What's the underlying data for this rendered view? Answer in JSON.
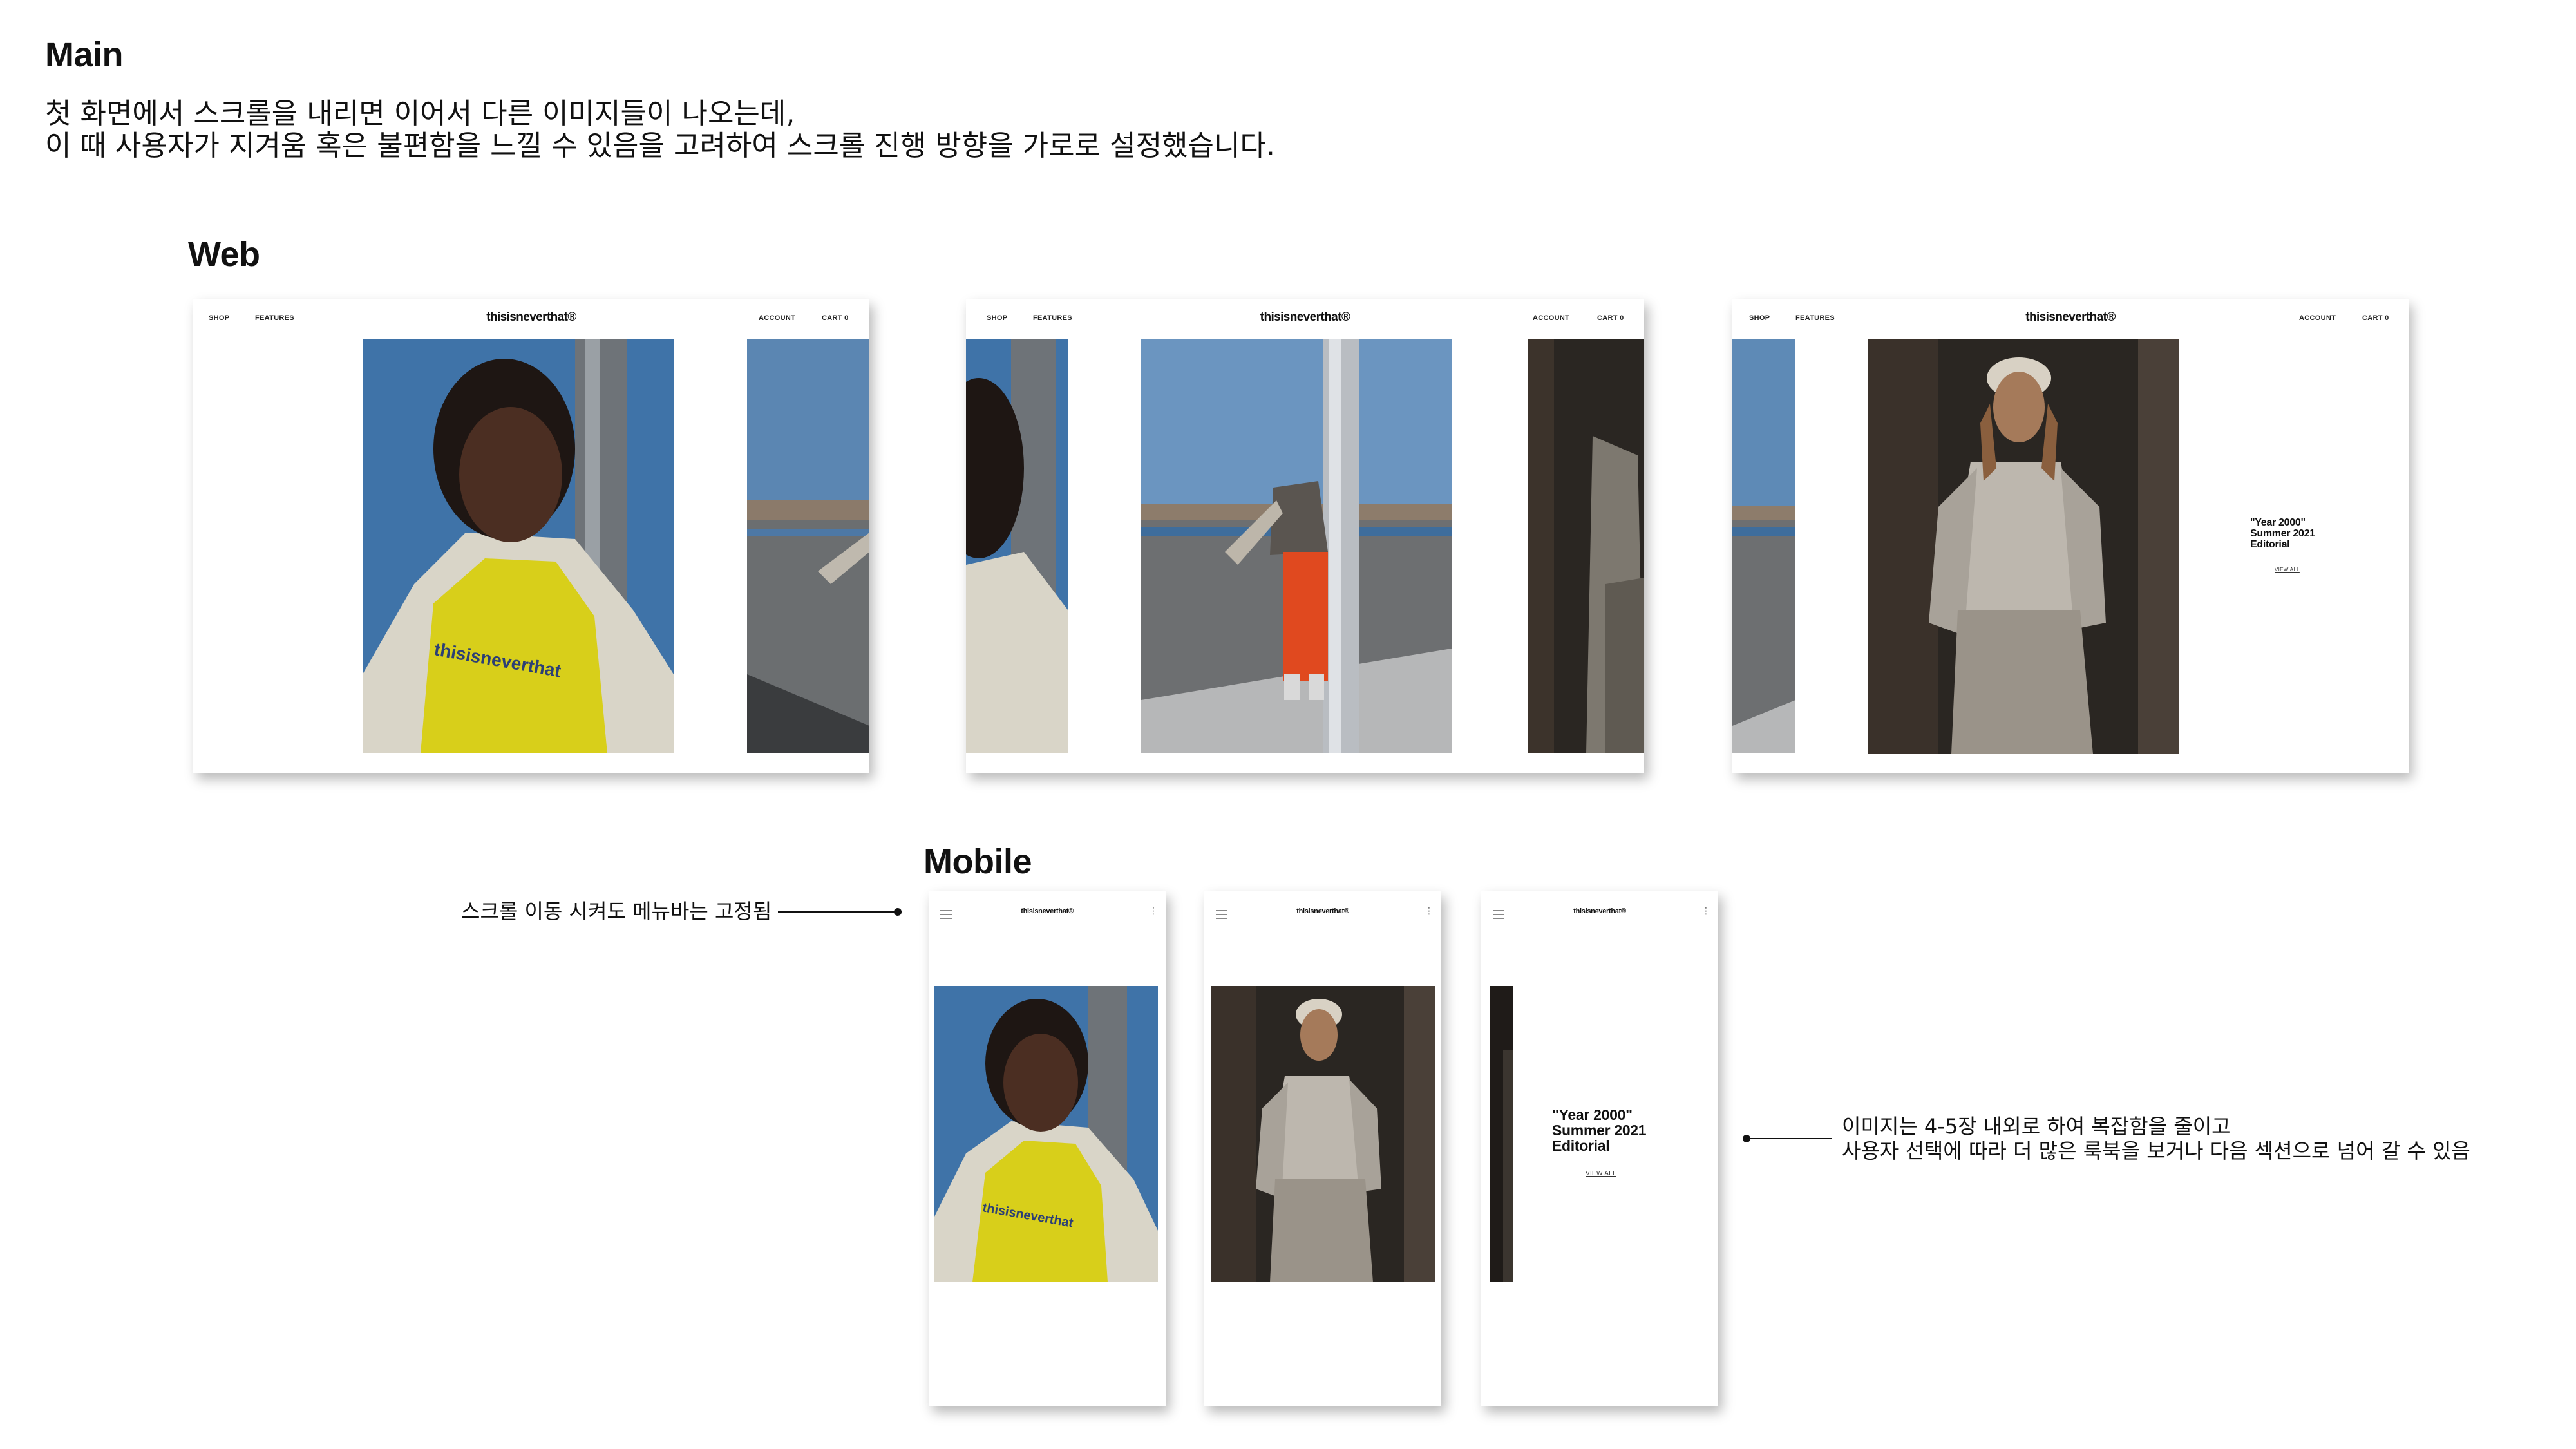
{
  "main": {
    "title": "Main",
    "description": [
      "첫 화면에서 스크롤을 내리면 이어서 다른 이미지들이 나오는데,",
      "이 때 사용자가 지겨움 혹은 불편함을 느낄 수 있음을 고려하여 스크롤 진행 방향을 가로로 설정했습니다."
    ]
  },
  "web": {
    "title": "Web",
    "nav": {
      "shop": "SHOP",
      "features": "FEATURES",
      "brand": "thisisneverthat®",
      "account": "ACCOUNT",
      "cart": "CART 0"
    },
    "photo_print": "thisisneverthat",
    "editorial": {
      "line1": "\"Year 2000\"",
      "line2": "Summer 2021",
      "line3": "Editorial",
      "view_all": "VIEW ALL"
    }
  },
  "mobile": {
    "title": "Mobile",
    "brand": "thisisneverthat®",
    "note_left": "스크롤 이동 시켜도 메뉴바는 고정됨",
    "note_right": [
      "이미지는 4-5장 내외로 하여 복잡함을 줄이고",
      "사용자 선택에 따라 더 많은 룩북을 보거나 다음 섹션으로 넘어 갈 수 있음"
    ],
    "editorial": {
      "line1": "\"Year 2000\"",
      "line2": "Summer 2021",
      "line3": "Editorial",
      "view_all": "VIEW ALL"
    }
  },
  "colors": {
    "sky": "#4e7fb0",
    "yellow": "#d8cf1a",
    "orange_pants": "#e0491f",
    "jacket": "#d9d5c8",
    "concrete": "#6f6f6f",
    "dark_street": "#2a2622",
    "sweatshirt": "#bdb7ae"
  }
}
